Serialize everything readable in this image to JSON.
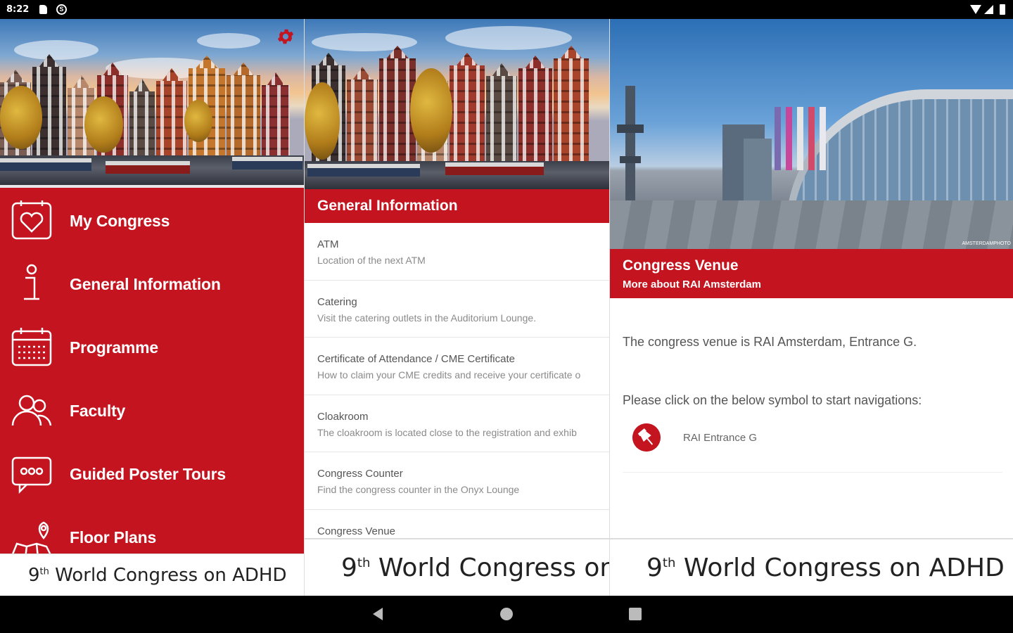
{
  "status_bar": {
    "time": "8:22",
    "notification_glyph": "S",
    "icons": [
      "sd-card-icon",
      "notification-icon",
      "wifi-icon",
      "signal-icon",
      "battery-icon"
    ]
  },
  "menu": {
    "settings_icon": "gear-icon",
    "items": [
      {
        "label": "My Congress",
        "icon": "heart-calendar-icon"
      },
      {
        "label": "General Information",
        "icon": "info-icon"
      },
      {
        "label": "Programme",
        "icon": "calendar-icon"
      },
      {
        "label": "Faculty",
        "icon": "people-icon"
      },
      {
        "label": "Guided Poster Tours",
        "icon": "chat-bubble-icon"
      },
      {
        "label": "Floor Plans",
        "icon": "map-pin-icon"
      }
    ]
  },
  "banner": {
    "ordinal": "9",
    "ordinal_suffix": "th",
    "text": "World Congress on ADHD"
  },
  "general_info": {
    "header": "General Information",
    "items": [
      {
        "title": "ATM",
        "subtitle": "Location of the next ATM"
      },
      {
        "title": "Catering",
        "subtitle": "Visit the catering outlets in the Auditorium Lounge."
      },
      {
        "title": "Certificate of Attendance / CME Certificate",
        "subtitle": "How to claim your CME credits and receive your certificate o"
      },
      {
        "title": "Cloakroom",
        "subtitle": "The cloakroom is located close to the registration and exhib"
      },
      {
        "title": "Congress Counter",
        "subtitle": "Find the congress counter in the Onyx Lounge"
      },
      {
        "title": "Congress Venue",
        "subtitle": ""
      }
    ]
  },
  "venue": {
    "title": "Congress Venue",
    "subtitle": "More about RAI Amsterdam",
    "photo_credit": "AMSTERDAMPHOTO",
    "paragraph1": "The congress venue is RAI Amsterdam, Entrance G.",
    "paragraph2": "Please click on the below symbol to start navigations:",
    "nav_label": "RAI Entrance G",
    "nav_icon": "map-pin-icon"
  },
  "colors": {
    "brand_red": "#c3141f",
    "text_grey": "#555555"
  }
}
